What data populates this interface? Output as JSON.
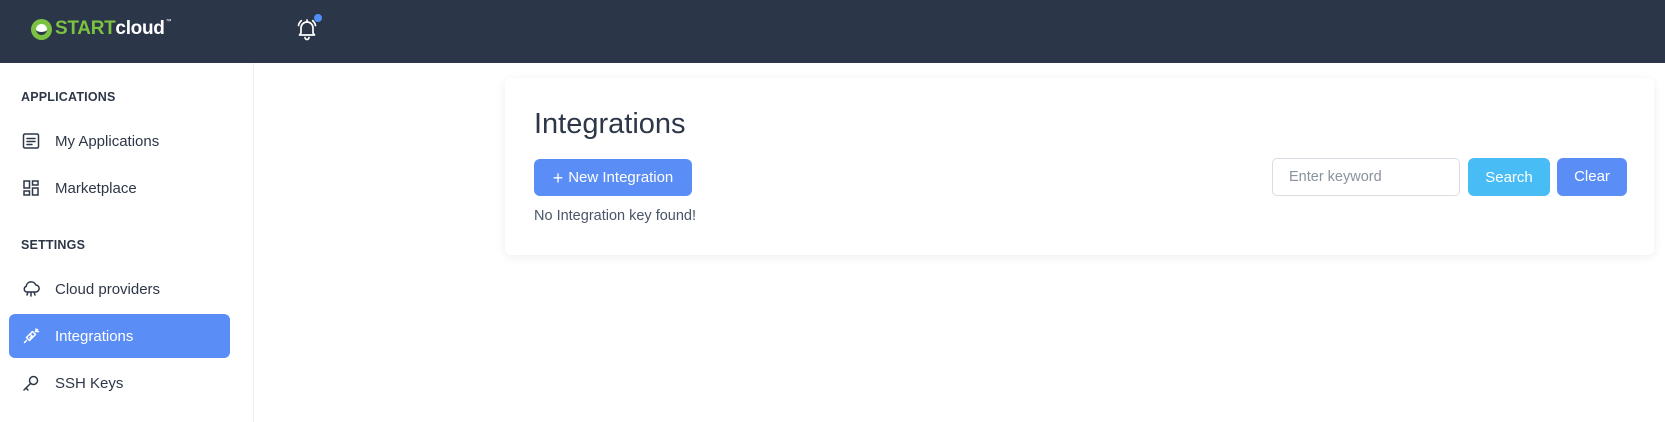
{
  "header": {
    "logo": {
      "start": "START",
      "cloud": "cloud",
      "tm": "™"
    },
    "notification_icon": "bell-icon",
    "colors": {
      "bar": "#2b3648",
      "brand_green": "#7cc242",
      "dot": "#4f8ff7"
    }
  },
  "sidebar": {
    "applications_title": "APPLICATIONS",
    "settings_title": "SETTINGS",
    "items": [
      {
        "label": "My Applications",
        "icon": "list-icon",
        "active": false
      },
      {
        "label": "Marketplace",
        "icon": "grid-icon",
        "active": false
      },
      {
        "label": "Cloud providers",
        "icon": "cloud-icon",
        "active": false
      },
      {
        "label": "Integrations",
        "icon": "plug-icon",
        "active": true
      },
      {
        "label": "SSH Keys",
        "icon": "key-icon",
        "active": false
      }
    ],
    "colors": {
      "active_bg": "#5b8df7"
    }
  },
  "main": {
    "title": "Integrations",
    "new_button": {
      "plus": "+",
      "label": "New Integration"
    },
    "empty_message": "No Integration key found!",
    "search": {
      "placeholder": "Enter keyword",
      "value": ""
    },
    "search_button": "Search",
    "clear_button": "Clear",
    "colors": {
      "primary": "#5b8df7",
      "search": "#48bdf5"
    }
  }
}
